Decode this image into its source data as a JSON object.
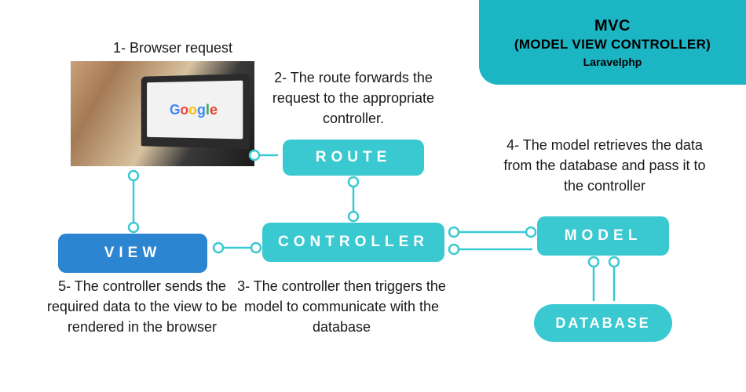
{
  "header": {
    "title": "MVC",
    "subtitle": "(MODEL VIEW CONTROLLER)",
    "tagline": "Laravelphp"
  },
  "captions": {
    "step1": "1- Browser request",
    "step2": "2- The route forwards the request to the appropriate controller.",
    "step3": "3- The controller then triggers the model to communicate with the database",
    "step4": "4- The model retrieves the data from the database and pass it to the controller",
    "step5": "5- The controller sends the required data to the view to be rendered in the browser"
  },
  "nodes": {
    "route": "ROUTE",
    "controller": "CONTROLLER",
    "view": "VIEW",
    "model": "MODEL",
    "database": "DATABASE"
  },
  "photo": {
    "alt": "browser-request-image",
    "search_engine": "Google"
  }
}
